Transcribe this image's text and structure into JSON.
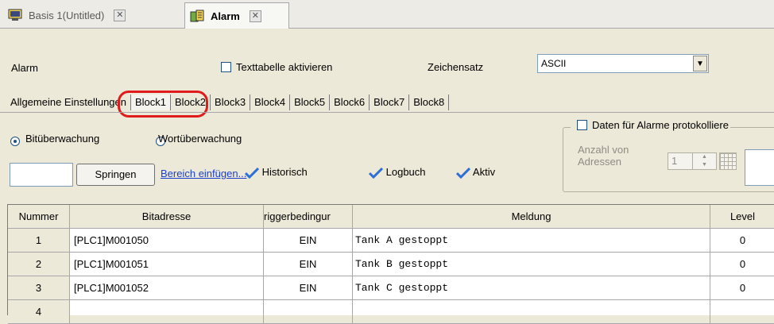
{
  "doc_tabs": [
    {
      "label": "Basis 1(Untitled)",
      "icon": "monitor-icon",
      "active": false
    },
    {
      "label": "Alarm",
      "icon": "alarm-panel-icon",
      "active": true
    }
  ],
  "settings": {
    "alarm_label": "Alarm",
    "texttable_label": "Texttabelle aktivieren",
    "texttable_checked": false,
    "charset_label": "Zeichensatz",
    "charset_value": "ASCII"
  },
  "block_tabs": [
    "Allgemeine Einstellungen",
    "Block1",
    "Block2",
    "Block3",
    "Block4",
    "Block5",
    "Block6",
    "Block7",
    "Block8"
  ],
  "active_block_tab": "Block1",
  "highlight_color": "#e01b1b",
  "monitoring": {
    "bit_label": "Bitüberwachung",
    "word_label": "Wortüberwachung",
    "selected": "bit"
  },
  "jump": {
    "input_value": "",
    "button_label": "Springen",
    "insert_link": "Bereich einfügen...",
    "history_label": "Historisch",
    "logbook_label": "Logbuch",
    "active_label": "Aktiv"
  },
  "protocol": {
    "title": "Daten für Alarme protokolliere",
    "count_label_1": "Anzahl von",
    "count_label_2": "Adressen",
    "count_value": "1"
  },
  "table": {
    "headers": [
      "Nummer",
      "Bitadresse",
      "riggerbedingur",
      "Meldung",
      "Level"
    ],
    "rows": [
      {
        "num": "1",
        "addr": "[PLC1]M001050",
        "trigger": "EIN",
        "msg": "Tank A gestoppt",
        "level": "0"
      },
      {
        "num": "2",
        "addr": "[PLC1]M001051",
        "trigger": "EIN",
        "msg": "Tank B gestoppt",
        "level": "0"
      },
      {
        "num": "3",
        "addr": "[PLC1]M001052",
        "trigger": "EIN",
        "msg": "Tank C gestoppt",
        "level": "0"
      },
      {
        "num": "4",
        "addr": "",
        "trigger": "",
        "msg": "",
        "level": ""
      }
    ]
  }
}
